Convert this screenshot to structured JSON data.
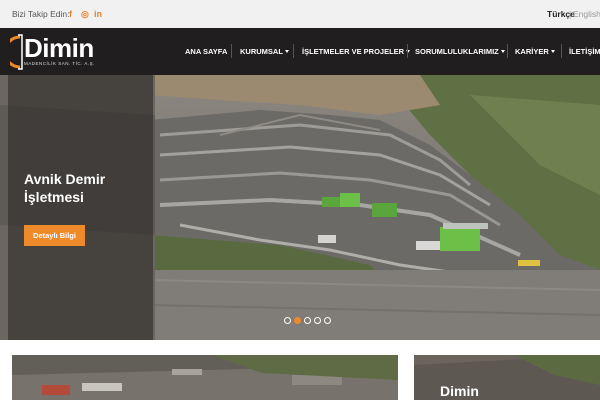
{
  "topbar": {
    "follow_label": "Bizi Takip Edin:",
    "social": [
      {
        "icon": "facebook-icon",
        "glyph": "f"
      },
      {
        "icon": "instagram-icon",
        "glyph": "◎"
      },
      {
        "icon": "linkedin-icon",
        "glyph": "in"
      }
    ],
    "lang_active": "Türkçe",
    "lang_sep": "|",
    "lang_other": "English"
  },
  "header": {
    "logo_text": "Dimin",
    "logo_sub": "MADENCİLİK SAN. TİC. A.Ş.",
    "nav": [
      {
        "label": "ANA SAYFA",
        "dropdown": false
      },
      {
        "label": "KURUMSAL",
        "dropdown": true
      },
      {
        "label": "İŞLETMELER VE PROJELER",
        "dropdown": true
      },
      {
        "label": "SORUMLULUKLARIMIZ",
        "dropdown": true
      },
      {
        "label": "KARİYER",
        "dropdown": true
      },
      {
        "label": "İLETİŞİM",
        "dropdown": false
      }
    ]
  },
  "hero": {
    "title": "Avnik Demir İşletmesi",
    "button": "Detaylı Bilgi",
    "slide_count": 5,
    "active_slide": 1
  },
  "cards": [
    {
      "title": ""
    },
    {
      "title": "Dimin"
    }
  ],
  "colors": {
    "accent": "#ef8a2a",
    "header_bg": "#201e1e",
    "topbar_bg": "#f1f1f1"
  }
}
